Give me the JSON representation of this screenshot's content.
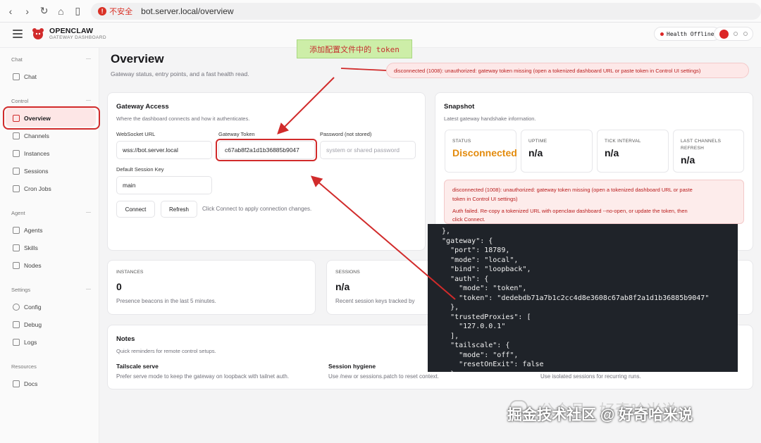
{
  "browser": {
    "security_label": "不安全",
    "url": "bot.server.local/overview"
  },
  "header": {
    "brand": "OPENCLAW",
    "brand_sub": "GATEWAY DASHBOARD",
    "health_label": "Health",
    "health_status": "Offline"
  },
  "sidebar": {
    "sections": {
      "chat": "Chat",
      "control": "Control",
      "agent": "Agent",
      "settings": "Settings",
      "resources": "Resources"
    },
    "items": {
      "chat": "Chat",
      "overview": "Overview",
      "channels": "Channels",
      "instances": "Instances",
      "sessions": "Sessions",
      "cron_jobs": "Cron Jobs",
      "agents": "Agents",
      "skills": "Skills",
      "nodes": "Nodes",
      "config": "Config",
      "debug": "Debug",
      "logs": "Logs",
      "docs": "Docs"
    }
  },
  "page": {
    "title": "Overview",
    "subtitle": "Gateway status, entry points, and a fast health read.",
    "error_banner": "disconnected (1008): unauthorized: gateway token missing (open a tokenized dashboard URL or paste token in Control UI settings)"
  },
  "gateway_access": {
    "title": "Gateway Access",
    "subtitle": "Where the dashboard connects and how it authenticates.",
    "ws_label": "WebSocket URL",
    "ws_value": "wss://bot.server.local",
    "token_label": "Gateway Token",
    "token_value": "c67ab8f2a1d1b36885b9047",
    "password_label": "Password (not stored)",
    "password_placeholder": "system or shared password",
    "session_key_label": "Default Session Key",
    "session_key_value": "main",
    "connect_label": "Connect",
    "refresh_label": "Refresh",
    "hint": "Click Connect to apply connection changes."
  },
  "snapshot": {
    "title": "Snapshot",
    "subtitle": "Latest gateway handshake information.",
    "stats": [
      {
        "label": "STATUS",
        "value": "Disconnected"
      },
      {
        "label": "UPTIME",
        "value": "n/a"
      },
      {
        "label": "TICK INTERVAL",
        "value": "n/a"
      },
      {
        "label": "LAST CHANNELS REFRESH",
        "value": "n/a"
      }
    ],
    "error_line1": "disconnected (1008): unauthorized: gateway token missing (open a tokenized dashboard URL or paste",
    "error_line2": "token in Control UI settings)",
    "auth_line1": "Auth failed. Re-copy a tokenized URL with openclaw dashboard --no-open, or update the token, then",
    "auth_line2": "click Connect."
  },
  "instances": {
    "label": "INSTANCES",
    "value": "0",
    "desc": "Presence beacons in the last 5 minutes."
  },
  "sessions": {
    "label": "SESSIONS",
    "value": "n/a",
    "desc": "Recent session keys tracked by"
  },
  "notes": {
    "title": "Notes",
    "subtitle": "Quick reminders for remote control setups.",
    "items": [
      {
        "title": "Tailscale serve",
        "desc": "Prefer serve mode to keep the gateway on loopback with tailnet auth."
      },
      {
        "title": "Session hygiene",
        "desc": "Use /new or sessions.patch to reset context."
      },
      {
        "title": "",
        "desc": "Use isolated sessions for recurring runs."
      }
    ]
  },
  "code_panel": {
    "lines": [
      "  },",
      "  \"gateway\": {",
      "    \"port\": 18789,",
      "    \"mode\": \"local\",",
      "    \"bind\": \"loopback\",",
      "    \"auth\": {",
      "      \"mode\": \"token\",",
      "      \"token\": \"dedebdb71a7b1c2cc4d8e3608c67ab8f2a1d1b36885b9047\"",
      "    },",
      "    \"trustedProxies\": [",
      "      \"127.0.0.1\"",
      "    ],",
      "    \"tailscale\": {",
      "      \"mode\": \"off\",",
      "      \"resetOnExit\": false",
      "    }"
    ]
  },
  "annotation": {
    "text": "添加配置文件中的 token"
  },
  "watermark": {
    "text": "掘金技术社区 @ 好奇哈米说",
    "faint": "公众号 · 好奇哈米说"
  }
}
